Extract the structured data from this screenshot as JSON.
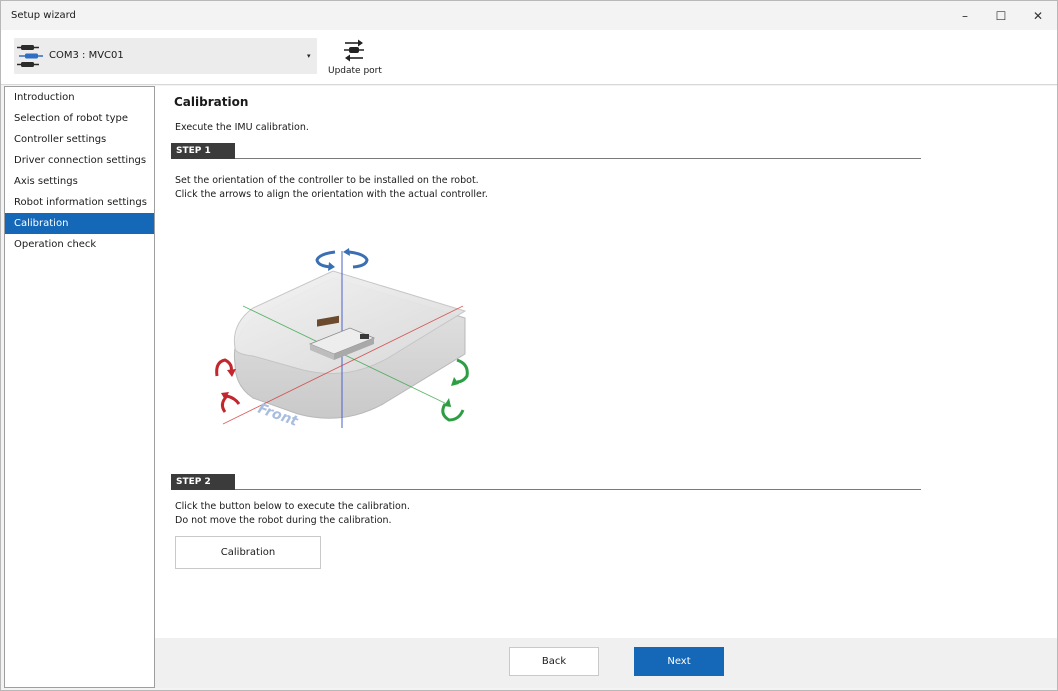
{
  "window": {
    "title": "Setup wizard",
    "minimize_label": "–",
    "maximize_label": "☐",
    "close_label": "✕"
  },
  "toolbar": {
    "port_value": "COM3 : MVC01",
    "port_dropdown_glyph": "▾",
    "update_port_label": "Update port"
  },
  "sidebar": {
    "items": [
      {
        "label": "Introduction",
        "active": false
      },
      {
        "label": "Selection of robot type",
        "active": false
      },
      {
        "label": "Controller settings",
        "active": false
      },
      {
        "label": "Driver connection settings",
        "active": false
      },
      {
        "label": "Axis settings",
        "active": false
      },
      {
        "label": "Robot information settings",
        "active": false
      },
      {
        "label": "Calibration",
        "active": true
      },
      {
        "label": "Operation check",
        "active": false
      }
    ]
  },
  "main": {
    "title": "Calibration",
    "intro": "Execute the IMU calibration.",
    "step1": {
      "tag": "STEP 1",
      "line1": "Set the orientation of the controller to be installed on the robot.",
      "line2": "Click the arrows to align the orientation with the actual controller."
    },
    "diagram": {
      "front_label": "Front"
    },
    "step2": {
      "tag": "STEP 2",
      "line1": "Click the button below to execute the calibration.",
      "line2": "Do not move the robot during the calibration.",
      "button_label": "Calibration"
    }
  },
  "footer": {
    "back_label": "Back",
    "next_label": "Next"
  },
  "colors": {
    "accent": "#1567b7",
    "step_tag": "#3b3b3b",
    "rotate_blue": "#3a6fb4",
    "rotate_red": "#c2272d",
    "rotate_green": "#2e9e44"
  }
}
